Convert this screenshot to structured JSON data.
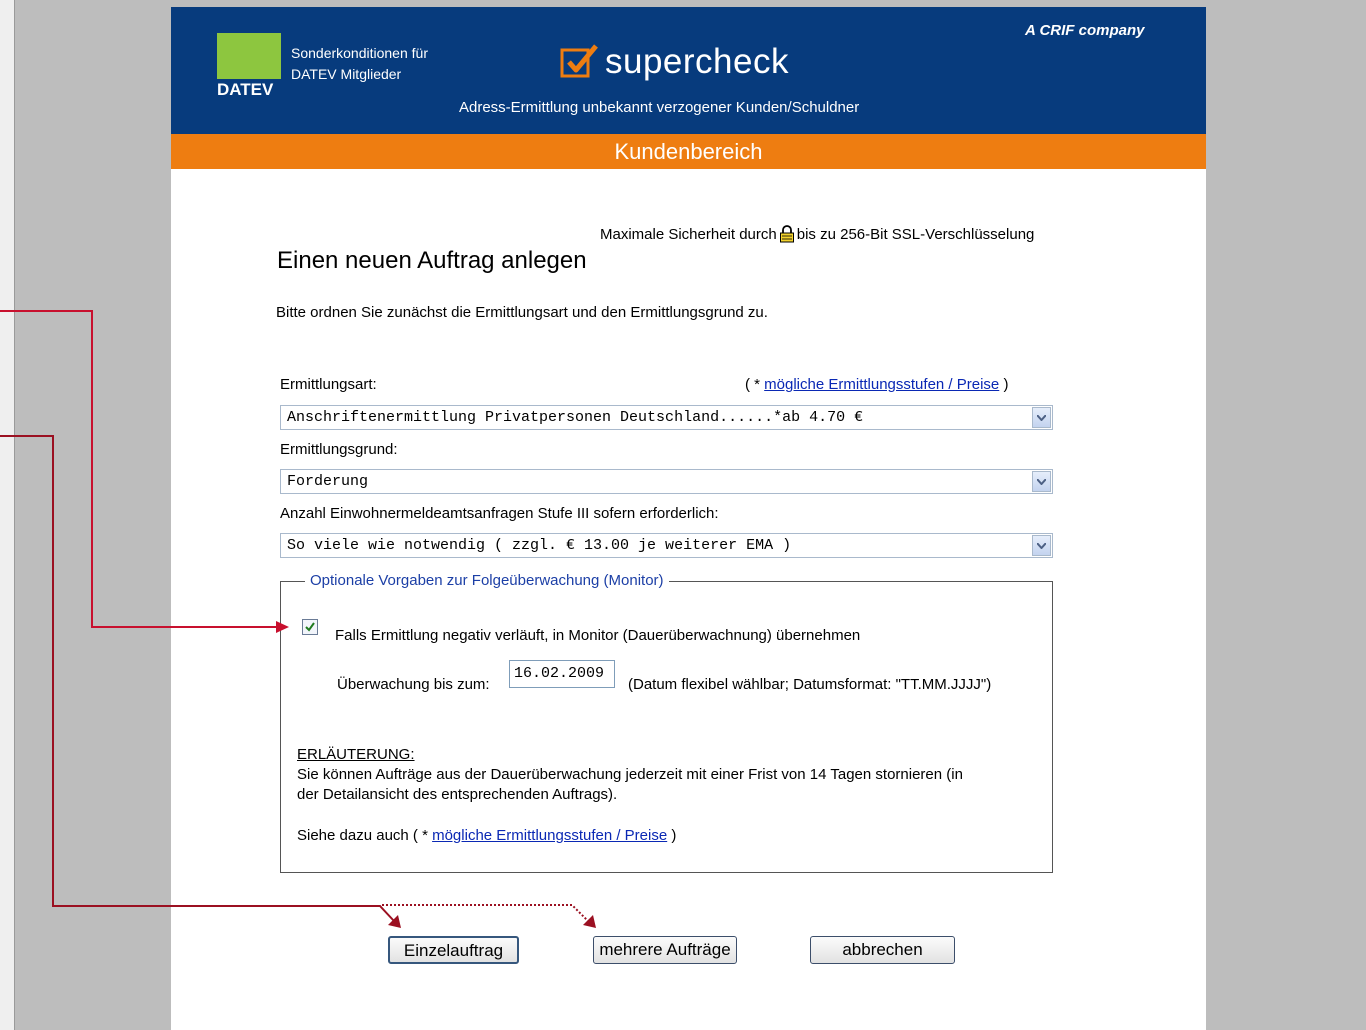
{
  "header": {
    "datev_label": "DATEV",
    "sonder_line1": "Sonderkonditionen für",
    "sonder_line2": "DATEV Mitglieder",
    "brand": "supercheck",
    "crif": "A  CRIF company",
    "subtitle": "Adress-Ermittlung unbekannt verzogener Kunden/Schuldner"
  },
  "nav": {
    "section": "Kundenbereich"
  },
  "security": {
    "before": "Maximale Sicherheit durch",
    "after": "bis zu 256-Bit SSL-Verschlüsselung",
    "icon": "lock-icon"
  },
  "main": {
    "heading": "Einen neuen Auftrag anlegen",
    "intro": "Bitte ordnen Sie zunächst die Ermittlungsart und den Ermittlungsgrund zu.",
    "art_label": "Ermittlungsart:",
    "prices_open": "( * ",
    "prices_link": "mögliche Ermittlungsstufen / Preise",
    "prices_close": " )",
    "art_value": "Anschriftenermittlung Privatpersonen Deutschland......*ab 4.70 €",
    "grund_label": "Ermittlungsgrund:",
    "grund_value": "Forderung",
    "anzahl_label": "Anzahl Einwohnermeldeamtsanfragen Stufe III sofern erforderlich:",
    "anzahl_value": "So viele wie notwendig ( zzgl. € 13.00 je weiterer EMA )"
  },
  "monitor": {
    "legend": "Optionale Vorgaben zur Folgeüberwachung (Monitor)",
    "checkbox_checked": true,
    "checkbox_label": "Falls Ermittlung negativ verläuft, in Monitor (Dauerüberwachnung) übernehmen",
    "until_label": "Überwachung bis zum:",
    "until_value": "16.02.2009",
    "until_hint": "(Datum flexibel wählbar; Datumsformat: \"TT.MM.JJJJ\")",
    "note_title": "ERLÄUTERUNG:",
    "note_line1": "Sie können Aufträge aus der Dauerüberwachung jederzeit mit einer Frist von 14 Tagen stornieren (in",
    "note_line2": "der Detailansicht des entsprechenden Auftrags).",
    "see_also": "Siehe dazu auch ( * ",
    "see_link": "mögliche Ermittlungsstufen / Preise",
    "see_close": " )"
  },
  "buttons": {
    "single": "Einzelauftrag",
    "multiple": "mehrere Aufträge",
    "cancel": "abbrechen"
  },
  "colors": {
    "header": "#073b7d",
    "orange": "#ee7d11",
    "datev_green": "#8dc63f",
    "annotation": "#c8102e"
  }
}
